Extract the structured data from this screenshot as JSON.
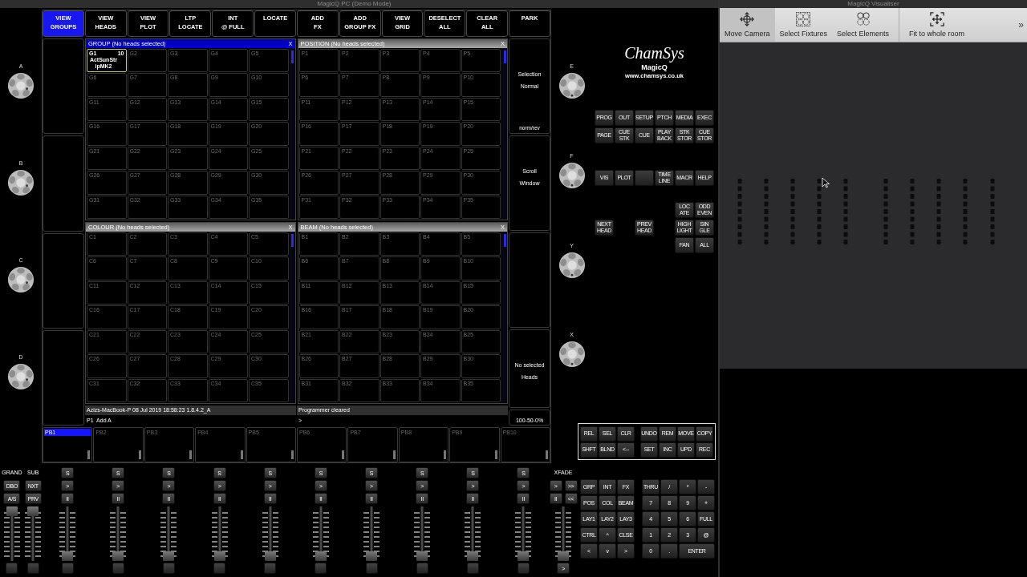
{
  "window_title": "MagicQ PC (Demo Mode)",
  "encoders_left": [
    "A",
    "B",
    "C",
    "D"
  ],
  "softkeys": [
    {
      "label": "VIEW\nGROUPS",
      "selected": true
    },
    {
      "label": "VIEW\nHEADS",
      "selected": false
    },
    {
      "label": "VIEW\nPLOT",
      "selected": false
    },
    {
      "label": "LTP\nLOCATE",
      "selected": false
    },
    {
      "label": "INT\n@ FULL",
      "selected": false
    },
    {
      "label": "LOCATE",
      "selected": false
    },
    {
      "label": "ADD\nFX",
      "selected": false
    },
    {
      "label": "ADD\nGROUP FX",
      "selected": false
    },
    {
      "label": "VIEW\nGRID",
      "selected": false
    },
    {
      "label": "DESELECT\nALL",
      "selected": false
    },
    {
      "label": "CLEAR\nALL",
      "selected": false
    },
    {
      "label": "PARK",
      "selected": false
    }
  ],
  "windows": [
    {
      "title": "GROUP (No heads selected)",
      "close": "X",
      "active": true,
      "cells": [
        {
          "label": "G1",
          "count": "10",
          "name": "ActSunStripMK2",
          "selected": true
        },
        {
          "label": "G2",
          "selected": false
        },
        {
          "label": "G3",
          "selected": false
        },
        {
          "label": "G4",
          "selected": false
        },
        {
          "label": "G5",
          "selected": false
        },
        {
          "label": "G6",
          "selected": false
        },
        {
          "label": "G7",
          "selected": false
        },
        {
          "label": "G8",
          "selected": false
        },
        {
          "label": "G9",
          "selected": false
        },
        {
          "label": "G10",
          "selected": false
        },
        {
          "label": "G11",
          "selected": false
        },
        {
          "label": "G12",
          "selected": false
        },
        {
          "label": "G13",
          "selected": false
        },
        {
          "label": "G14",
          "selected": false
        },
        {
          "label": "G15",
          "selected": false
        },
        {
          "label": "G16",
          "selected": false
        },
        {
          "label": "G17",
          "selected": false
        },
        {
          "label": "G18",
          "selected": false
        },
        {
          "label": "G19",
          "selected": false
        },
        {
          "label": "G20",
          "selected": false
        },
        {
          "label": "G21",
          "selected": false
        },
        {
          "label": "G22",
          "selected": false
        },
        {
          "label": "G23",
          "selected": false
        },
        {
          "label": "G24",
          "selected": false
        },
        {
          "label": "G25",
          "selected": false
        },
        {
          "label": "G26",
          "selected": false
        },
        {
          "label": "G27",
          "selected": false
        },
        {
          "label": "G28",
          "selected": false
        },
        {
          "label": "G29",
          "selected": false
        },
        {
          "label": "G30",
          "selected": false
        },
        {
          "label": "G31",
          "selected": false
        },
        {
          "label": "G32",
          "selected": false
        },
        {
          "label": "G33",
          "selected": false
        },
        {
          "label": "G34",
          "selected": false
        },
        {
          "label": "G35",
          "selected": false
        }
      ]
    },
    {
      "title": "POSITION (No heads selected)",
      "close": "X",
      "active": false,
      "cells": [
        "P1",
        "P2",
        "P3",
        "P4",
        "P5",
        "P6",
        "P7",
        "P8",
        "P9",
        "P10",
        "P11",
        "P12",
        "P13",
        "P14",
        "P15",
        "P16",
        "P17",
        "P18",
        "P19",
        "P20",
        "P21",
        "P22",
        "P23",
        "P24",
        "P25",
        "P26",
        "P27",
        "P28",
        "P29",
        "P30",
        "P31",
        "P32",
        "P33",
        "P34",
        "P35"
      ]
    },
    {
      "title": "COLOUR (No heads selected)",
      "close": "X",
      "active": false,
      "cells": [
        "C1",
        "C2",
        "C3",
        "C4",
        "C5",
        "C6",
        "C7",
        "C8",
        "C9",
        "C10",
        "C11",
        "C12",
        "C13",
        "C14",
        "C15",
        "C16",
        "C17",
        "C18",
        "C19",
        "C20",
        "C21",
        "C22",
        "C23",
        "C24",
        "C25",
        "C26",
        "C27",
        "C28",
        "C29",
        "C30",
        "C31",
        "C32",
        "C33",
        "C34",
        "C35"
      ]
    },
    {
      "title": "BEAM (No heads selected)",
      "close": "X",
      "active": false,
      "cells": [
        "B1",
        "B2",
        "B3",
        "B4",
        "B5",
        "B6",
        "B7",
        "B8",
        "B9",
        "B10",
        "B11",
        "B12",
        "B13",
        "B14",
        "B15",
        "B16",
        "B17",
        "B18",
        "B19",
        "B20",
        "B21",
        "B22",
        "B23",
        "B24",
        "B25",
        "B26",
        "B27",
        "B28",
        "B29",
        "B30",
        "B31",
        "B32",
        "B33",
        "B34",
        "B35"
      ]
    }
  ],
  "side_boxes": [
    {
      "kind": "text",
      "text": "Selection\nNormal",
      "footer": "norm/rev"
    },
    {
      "kind": "text",
      "text": "Scroll\nWindow"
    },
    {
      "kind": "empty"
    },
    {
      "kind": "text",
      "text": "No selected\nHeads"
    }
  ],
  "status": {
    "info": "Azizs-MacBook-P 08 Jul 2019 18:58:23 1.8.4.2_A",
    "message": "Programmer cleared",
    "command": "P1  Add A",
    "prompt": ">",
    "fade_mode": "100-50-0%"
  },
  "playbacks": [
    {
      "label": "PB1",
      "selected": true
    },
    {
      "label": "PB2",
      "selected": false
    },
    {
      "label": "PB3",
      "selected": false
    },
    {
      "label": "PB4",
      "selected": false
    },
    {
      "label": "PB5",
      "selected": false
    },
    {
      "label": "PB6",
      "selected": false
    },
    {
      "label": "PB7",
      "selected": false
    },
    {
      "label": "PB8",
      "selected": false
    },
    {
      "label": "PB9",
      "selected": false
    },
    {
      "label": "PB10",
      "selected": false
    }
  ],
  "fader_columns": [
    {
      "kind": "master",
      "label": "GRAND",
      "buttons": [
        "DBO",
        "A/S"
      ],
      "level": 1
    },
    {
      "kind": "master",
      "label": "SUB",
      "buttons": [
        "NXT",
        "PRV"
      ],
      "level": 1
    },
    {
      "kind": "playback",
      "buttons": [
        "S",
        ">",
        "II"
      ],
      "level": 0
    },
    {
      "kind": "playback",
      "buttons": [
        "S",
        ">",
        "II"
      ],
      "level": 0
    },
    {
      "kind": "playback",
      "buttons": [
        "S",
        ">",
        "II"
      ],
      "level": 0
    },
    {
      "kind": "playback",
      "buttons": [
        "S",
        ">",
        "II"
      ],
      "level": 0
    },
    {
      "kind": "playback",
      "buttons": [
        "S",
        ">",
        "II"
      ],
      "level": 0
    },
    {
      "kind": "playback",
      "buttons": [
        "S",
        ">",
        "II"
      ],
      "level": 0
    },
    {
      "kind": "playback",
      "buttons": [
        "S",
        ">",
        "II"
      ],
      "level": 0
    },
    {
      "kind": "playback",
      "buttons": [
        "S",
        ">",
        "II"
      ],
      "level": 0
    },
    {
      "kind": "playback",
      "buttons": [
        "S",
        ">",
        "II"
      ],
      "level": 0
    },
    {
      "kind": "playback",
      "buttons": [
        "S",
        ">",
        "II"
      ],
      "level": 0
    },
    {
      "kind": "xfade",
      "label": "XFADE",
      "button_rows": [
        [
          ">",
          ">>"
        ],
        [
          "II",
          "<<"
        ]
      ],
      "bottom": ">",
      "level": 0
    }
  ],
  "encoders_right": [
    "E",
    "F",
    "Y",
    "X"
  ],
  "logo": {
    "brand": "ChamSys",
    "product": "MagicQ",
    "url": "www.chamsys.co.uk"
  },
  "key_sections": [
    [
      [
        {
          "kind": "key",
          "label": "PROG"
        },
        {
          "kind": "key",
          "label": "OUT"
        },
        {
          "kind": "key",
          "label": "SETUP"
        },
        {
          "kind": "key",
          "label": "PTCH"
        },
        {
          "kind": "key",
          "label": "MEDIA"
        },
        {
          "kind": "key",
          "label": "EXEC"
        }
      ],
      [
        {
          "kind": "key",
          "label": "PAGE"
        },
        {
          "kind": "key",
          "label": "CUE\nSTK"
        },
        {
          "kind": "key",
          "label": "CUE"
        },
        {
          "kind": "key",
          "label": "PLAY\nBACK"
        },
        {
          "kind": "key",
          "label": "STK\nSTOR"
        },
        {
          "kind": "key",
          "label": "CUE\nSTOR"
        }
      ]
    ],
    [
      [
        {
          "kind": "key",
          "label": "VIS"
        },
        {
          "kind": "key",
          "label": "PLOT"
        },
        {
          "kind": "blank"
        },
        {
          "kind": "key",
          "label": "TIME\nLINE"
        },
        {
          "kind": "key",
          "label": "MACR"
        },
        {
          "kind": "key",
          "label": "HELP"
        }
      ]
    ],
    [
      [
        {
          "kind": "gap"
        },
        {
          "kind": "gap"
        },
        {
          "kind": "gap"
        },
        {
          "kind": "gap"
        },
        {
          "kind": "key",
          "label": "LOC\nATE"
        },
        {
          "kind": "key",
          "label": "ODD\nEVEN"
        }
      ],
      [
        {
          "kind": "key",
          "label": "NEXT\nHEAD"
        },
        {
          "kind": "gap"
        },
        {
          "kind": "key",
          "label": "PREV\nHEAD"
        },
        {
          "kind": "gap"
        },
        {
          "kind": "key",
          "label": "HIGH\nLIGHT"
        },
        {
          "kind": "key",
          "label": "SIN\nGLE"
        }
      ],
      [
        {
          "kind": "gap"
        },
        {
          "kind": "gap"
        },
        {
          "kind": "gap"
        },
        {
          "kind": "gap"
        },
        {
          "kind": "key",
          "label": "FAN"
        },
        {
          "kind": "key",
          "label": "ALL"
        }
      ]
    ]
  ],
  "keypad": {
    "top_left": [
      "REL",
      "SEL",
      "CLR",
      "SHFT",
      "BLND",
      "<--"
    ],
    "top_right": [
      "UNDO",
      "REM",
      "MOVE",
      "COPY",
      "SET",
      "INC",
      "UPD",
      "REC"
    ],
    "functions": [
      "GRP",
      "INT",
      "FX",
      "POS",
      "COL",
      "BEAM",
      "LAY1",
      "LAY2",
      "LAY3",
      "CTRL",
      "^",
      "CLSE",
      "<",
      "v",
      ">"
    ],
    "numeric": [
      {
        "kind": "key",
        "label": "THRU"
      },
      {
        "kind": "key",
        "label": "/"
      },
      {
        "kind": "key",
        "label": "*"
      },
      {
        "kind": "key",
        "label": "-"
      },
      {
        "kind": "key",
        "label": "7"
      },
      {
        "kind": "key",
        "label": "8"
      },
      {
        "kind": "key",
        "label": "9"
      },
      {
        "kind": "key",
        "label": "+"
      },
      {
        "kind": "key",
        "label": "4"
      },
      {
        "kind": "key",
        "label": "5"
      },
      {
        "kind": "key",
        "label": "6"
      },
      {
        "kind": "key",
        "label": "FULL"
      },
      {
        "kind": "key",
        "label": "1"
      },
      {
        "kind": "key",
        "label": "2"
      },
      {
        "kind": "key",
        "label": "3"
      },
      {
        "kind": "key",
        "label": "@"
      },
      {
        "kind": "key",
        "label": "0"
      },
      {
        "kind": "key",
        "label": "."
      },
      {
        "kind": "wide",
        "label": "ENTER"
      }
    ]
  },
  "visualiser": {
    "title": "MagicQ Visualiser",
    "overflow": "»",
    "tools": [
      {
        "kind": "move",
        "label": "Move Camera",
        "selected": true
      },
      {
        "kind": "fixtures",
        "label": "Select Fixtures",
        "selected": false
      },
      {
        "kind": "elements",
        "label": "Select Elements",
        "selected": false
      },
      {
        "kind": "fit",
        "label": "Fit to whole room",
        "selected": false
      }
    ]
  }
}
